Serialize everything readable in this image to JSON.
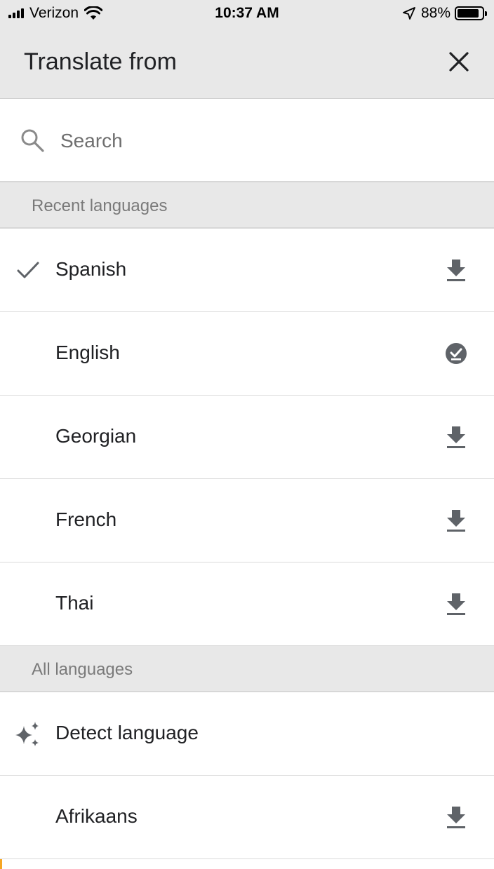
{
  "status_bar": {
    "carrier": "Verizon",
    "time": "10:37 AM",
    "battery": "88%",
    "battery_level": 0.88
  },
  "header": {
    "title": "Translate from",
    "close_icon": "close-icon"
  },
  "search": {
    "placeholder": "Search",
    "icon": "search-icon"
  },
  "sections": {
    "recent": "Recent languages",
    "all": "All languages"
  },
  "recent_languages": [
    {
      "label": "Spanish",
      "selected": true,
      "status_icon": "download-icon"
    },
    {
      "label": "English",
      "selected": false,
      "status_icon": "downloaded-check-icon"
    },
    {
      "label": "Georgian",
      "selected": false,
      "status_icon": "download-icon"
    },
    {
      "label": "French",
      "selected": false,
      "status_icon": "download-icon"
    },
    {
      "label": "Thai",
      "selected": false,
      "status_icon": "download-icon"
    }
  ],
  "all_languages": [
    {
      "label": "Detect language",
      "status_icon": "sparkle-icon"
    },
    {
      "label": "Afrikaans",
      "status_icon": "download-icon"
    }
  ],
  "colors": {
    "header_bg": "#e8e8e8",
    "text": "#202124",
    "icon": "#5f6368"
  }
}
